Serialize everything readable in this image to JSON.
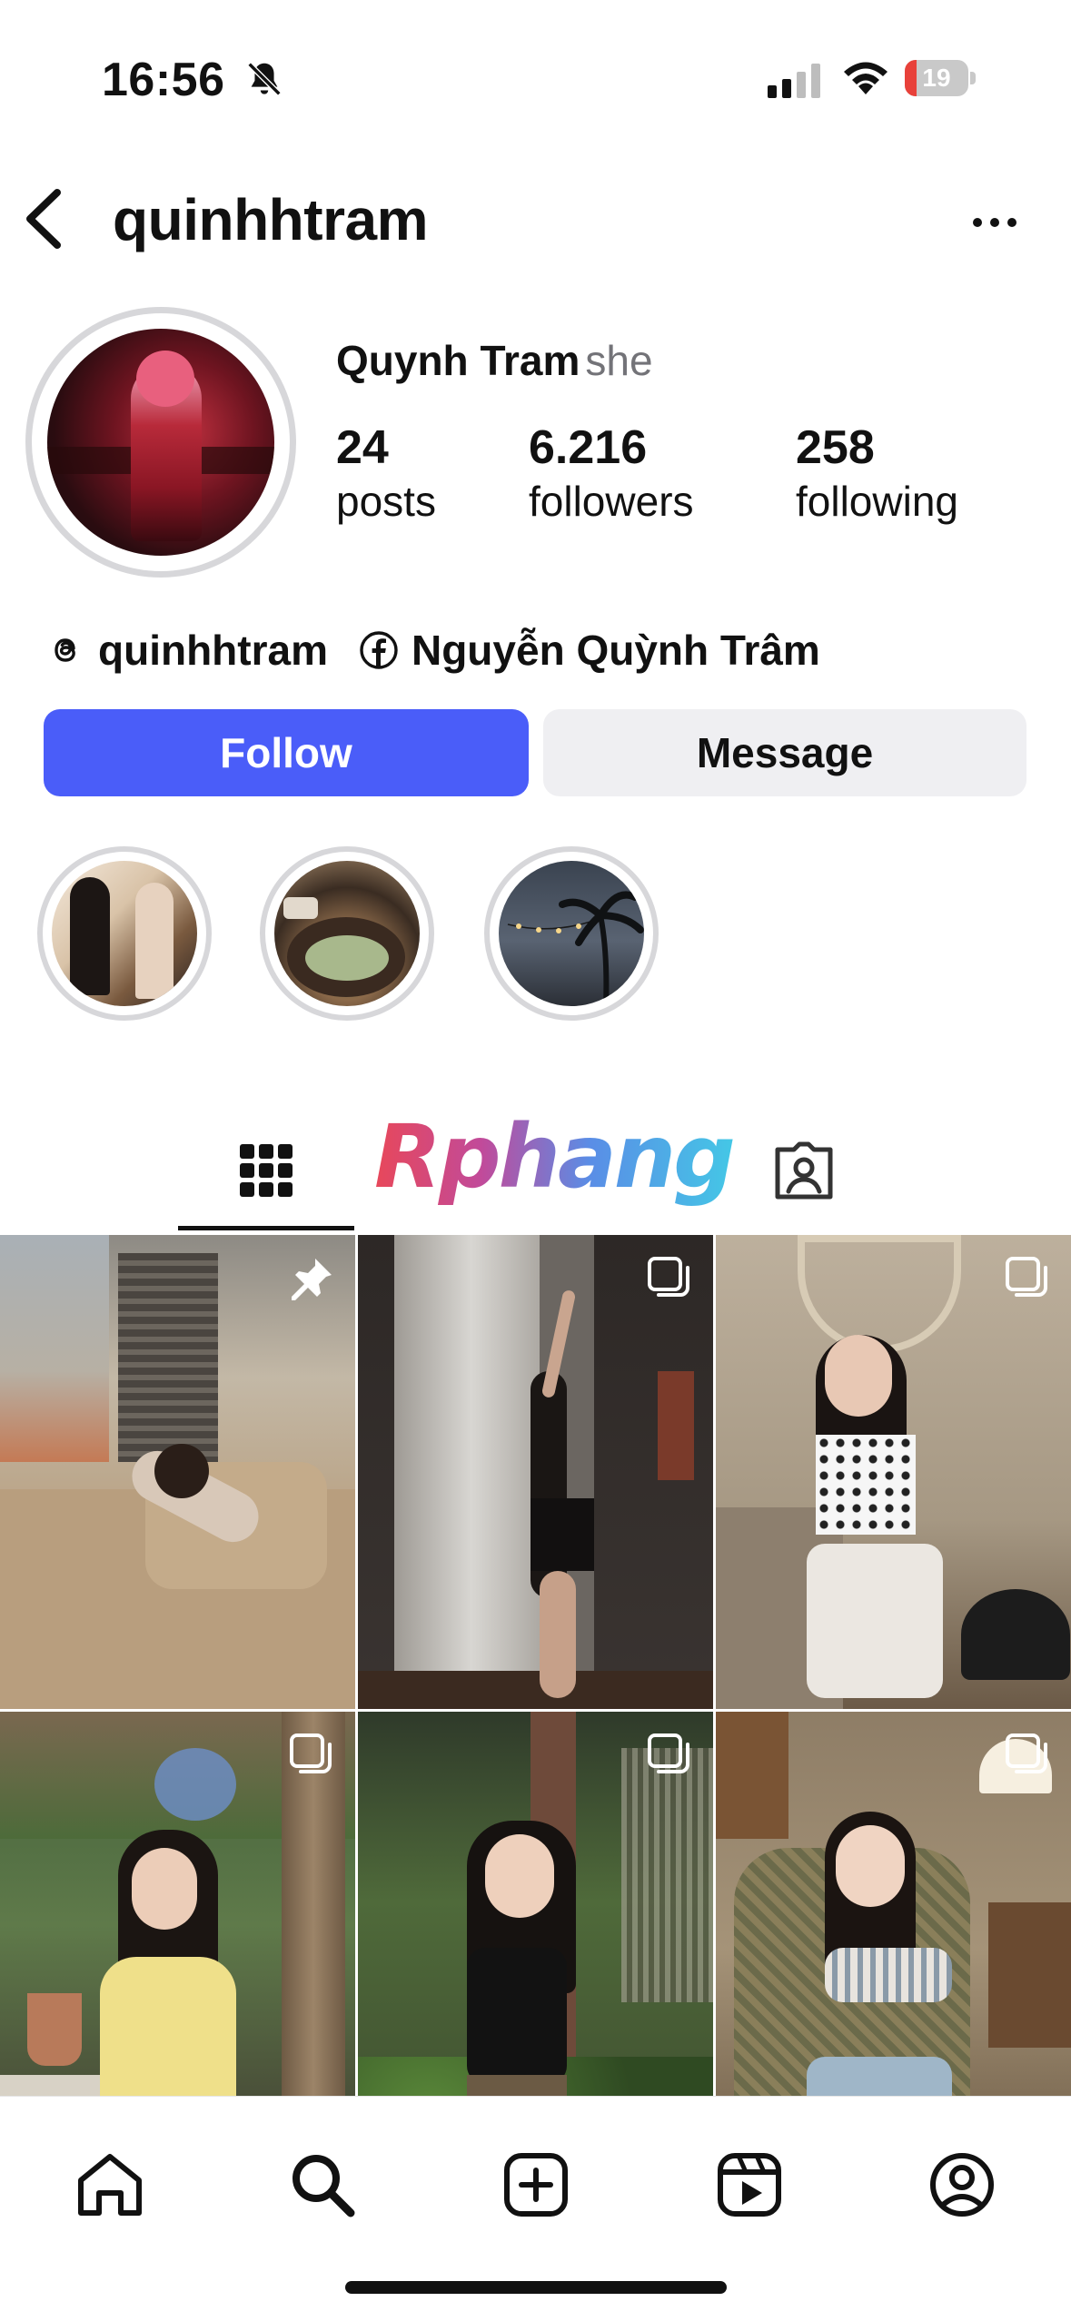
{
  "status_bar": {
    "time": "16:56",
    "battery_level": "19",
    "battery_fraction": 0.19,
    "icons": [
      "bell-slash-icon",
      "cellular-signal-icon",
      "wifi-icon",
      "battery-icon"
    ]
  },
  "header": {
    "username": "quinhhtram",
    "icons": [
      "chevron-left-icon",
      "more-horizontal-icon"
    ]
  },
  "profile": {
    "display_name": "Quynh Tram",
    "pronouns": "she",
    "stats": {
      "posts": {
        "value": "24",
        "label": "posts"
      },
      "followers": {
        "value": "6.216",
        "label": "followers"
      },
      "following": {
        "value": "258",
        "label": "following"
      }
    },
    "links": {
      "threads": "quinhhtram",
      "facebook": "Nguyễn Quỳnh Trâm"
    }
  },
  "actions": {
    "follow": "Follow",
    "message": "Message"
  },
  "highlights": {
    "count": 3
  },
  "tabs": {
    "active": "grid",
    "icons": [
      "grid-icon",
      "tagged-icon"
    ]
  },
  "watermark": {
    "text": "Rphang"
  },
  "grid": {
    "posts": [
      {
        "icon": "pin-icon"
      },
      {
        "icon": "carousel-icon"
      },
      {
        "icon": "carousel-icon"
      },
      {
        "icon": "carousel-icon"
      },
      {
        "icon": "carousel-icon"
      },
      {
        "icon": "carousel-icon"
      }
    ]
  },
  "bottom_nav": {
    "items": [
      "home-icon",
      "search-icon",
      "create-icon",
      "reels-icon",
      "profile-icon"
    ]
  },
  "colors": {
    "follow_button": "#4a5df9",
    "message_button": "#efeff2",
    "battery_low": "#e8413a"
  }
}
